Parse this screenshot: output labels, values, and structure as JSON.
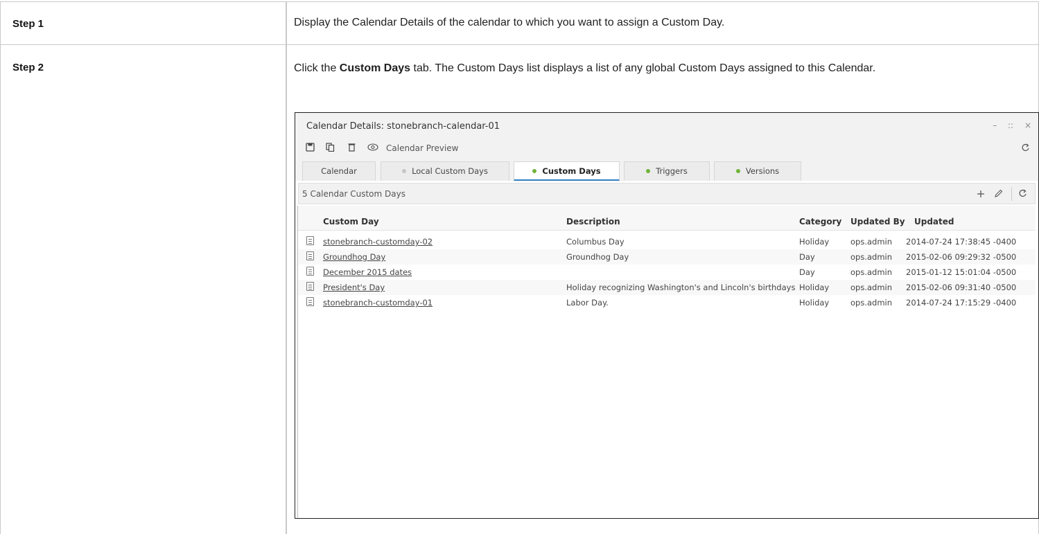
{
  "steps": [
    {
      "label": "Step 1",
      "text": "Display the Calendar Details of the calendar to which you want to assign a Custom Day."
    },
    {
      "label": "Step 2",
      "text_pre": "Click the ",
      "text_bold": "Custom Days",
      "text_post": " tab. The Custom Days list displays a list of any global Custom Days assigned to this Calendar."
    }
  ],
  "window": {
    "title": "Calendar Details: stonebranch-calendar-01",
    "controls": {
      "minimize": "–",
      "maximize": "::",
      "close": "×"
    },
    "toolbar": {
      "preview_label": "Calendar Preview"
    },
    "tabs": [
      {
        "label": "Calendar",
        "dot": "none"
      },
      {
        "label": "Local Custom Days",
        "dot": "grey"
      },
      {
        "label": "Custom Days",
        "dot": "green",
        "active": true
      },
      {
        "label": "Triggers",
        "dot": "green"
      },
      {
        "label": "Versions",
        "dot": "green"
      }
    ],
    "list": {
      "count_label": "5 Calendar Custom Days",
      "columns": [
        "Custom Day",
        "Description",
        "Category",
        "Updated By",
        "Updated"
      ],
      "rows": [
        {
          "name": "stonebranch-customday-02",
          "description": "Columbus Day",
          "category": "Holiday",
          "updated_by": "ops.admin",
          "updated": "2014-07-24 17:38:45 -0400"
        },
        {
          "name": "Groundhog Day",
          "description": "Groundhog Day",
          "category": "Day",
          "updated_by": "ops.admin",
          "updated": "2015-02-06 09:29:32 -0500"
        },
        {
          "name": "December 2015 dates",
          "description": "",
          "category": "Day",
          "updated_by": "ops.admin",
          "updated": "2015-01-12 15:01:04 -0500"
        },
        {
          "name": "President's Day",
          "description": "Holiday recognizing Washington's and Lincoln's birthdays",
          "category": "Holiday",
          "updated_by": "ops.admin",
          "updated": "2015-02-06 09:31:40 -0500"
        },
        {
          "name": "stonebranch-customday-01",
          "description": "Labor Day.",
          "category": "Holiday",
          "updated_by": "ops.admin",
          "updated": "2014-07-24 17:15:29 -0400"
        }
      ]
    },
    "colors": {
      "active_tab_underline": "#2f7fc2",
      "status_green": "#71b33a",
      "status_grey": "#c6c6c6"
    }
  }
}
